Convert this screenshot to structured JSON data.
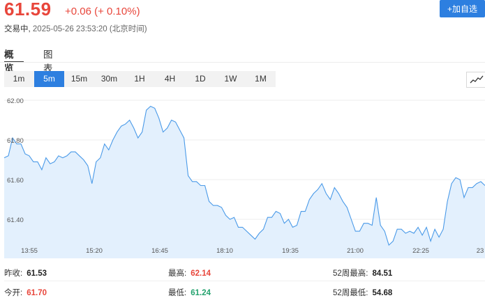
{
  "header": {
    "price": "61.59",
    "change": "+0.06 (+ 0.10%)",
    "status": "交易中,",
    "timestamp": "2025-05-26 23:53:20",
    "timezone": "(北京时间)",
    "add_watch_label": "+加自选"
  },
  "tabs": [
    {
      "label": "概览",
      "active": true
    },
    {
      "label": "图表",
      "active": false
    }
  ],
  "intervals": [
    {
      "label": "1m",
      "active": false
    },
    {
      "label": "5m",
      "active": true
    },
    {
      "label": "15m",
      "active": false
    },
    {
      "label": "30m",
      "active": false
    },
    {
      "label": "1H",
      "active": false
    },
    {
      "label": "4H",
      "active": false
    },
    {
      "label": "1D",
      "active": false
    },
    {
      "label": "1W",
      "active": false
    },
    {
      "label": "1M",
      "active": false
    }
  ],
  "chart_icon": "line-chart-icon",
  "colors": {
    "up": "#e8463b",
    "down": "#25a36f",
    "accent": "#2d7fe0",
    "line": "#4a9ae8",
    "fill": "#e3f0fd"
  },
  "chart_data": {
    "type": "area",
    "ylim": [
      61.3,
      62.05
    ],
    "y_ticks": [
      "62.00",
      "61.80",
      "61.60",
      "61.40"
    ],
    "x_ticks": [
      "13:55",
      "15:20",
      "16:45",
      "18:10",
      "19:35",
      "21:00",
      "22:25",
      "23"
    ],
    "grid": true,
    "values": [
      61.71,
      61.72,
      61.81,
      61.78,
      61.78,
      61.73,
      61.72,
      61.69,
      61.69,
      61.65,
      61.71,
      61.68,
      61.69,
      61.72,
      61.71,
      61.72,
      61.74,
      61.74,
      61.72,
      61.7,
      61.67,
      61.58,
      61.69,
      61.71,
      61.78,
      61.75,
      61.8,
      61.84,
      61.87,
      61.88,
      61.9,
      61.86,
      61.81,
      61.84,
      61.95,
      61.97,
      61.96,
      61.91,
      61.84,
      61.86,
      61.9,
      61.89,
      61.85,
      61.81,
      61.62,
      61.59,
      61.59,
      61.57,
      61.57,
      61.49,
      61.47,
      61.47,
      61.46,
      61.42,
      61.4,
      61.41,
      61.36,
      61.36,
      61.34,
      61.32,
      61.3,
      61.33,
      61.35,
      61.41,
      61.41,
      61.44,
      61.43,
      61.38,
      61.4,
      61.36,
      61.37,
      61.44,
      61.44,
      61.5,
      61.53,
      61.55,
      61.58,
      61.53,
      61.5,
      61.56,
      61.53,
      61.49,
      61.46,
      61.4,
      61.34,
      61.34,
      61.38,
      61.38,
      61.37,
      61.51,
      61.37,
      61.34,
      61.27,
      61.29,
      61.35,
      61.35,
      61.33,
      61.34,
      61.33,
      61.36,
      61.32,
      61.36,
      61.29,
      61.35,
      61.31,
      61.35,
      61.49,
      61.58,
      61.61,
      61.6,
      61.51,
      61.56,
      61.56,
      61.58,
      61.59,
      61.57
    ]
  },
  "stats": {
    "prev_close_label": "昨收:",
    "prev_close_value": "61.53",
    "high_label": "最高:",
    "high_value": "62.14",
    "week52_high_label": "52周最高:",
    "week52_high_value": "84.51",
    "open_label": "今开:",
    "open_value": "61.70",
    "low_label": "最低:",
    "low_value": "61.24",
    "week52_low_label": "52周最低:",
    "week52_low_value": "54.68"
  }
}
